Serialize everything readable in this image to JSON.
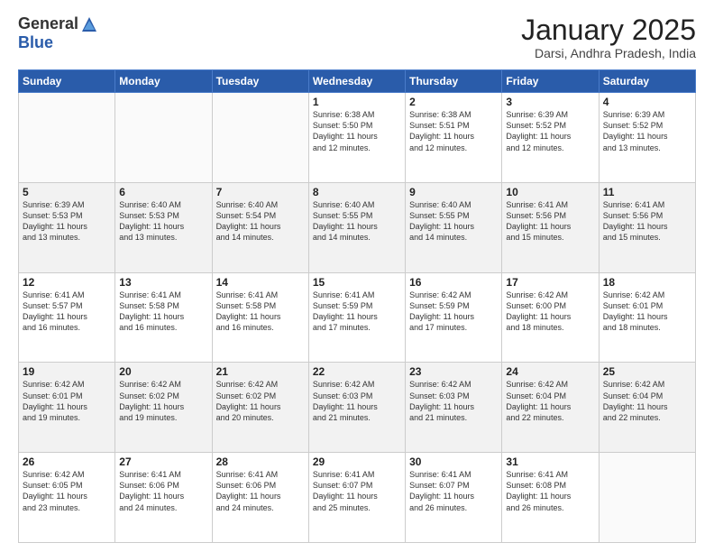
{
  "header": {
    "logo_general": "General",
    "logo_blue": "Blue",
    "month_title": "January 2025",
    "location": "Darsi, Andhra Pradesh, India"
  },
  "days_of_week": [
    "Sunday",
    "Monday",
    "Tuesday",
    "Wednesday",
    "Thursday",
    "Friday",
    "Saturday"
  ],
  "weeks": [
    [
      {
        "day": "",
        "info": ""
      },
      {
        "day": "",
        "info": ""
      },
      {
        "day": "",
        "info": ""
      },
      {
        "day": "1",
        "info": "Sunrise: 6:38 AM\nSunset: 5:50 PM\nDaylight: 11 hours\nand 12 minutes."
      },
      {
        "day": "2",
        "info": "Sunrise: 6:38 AM\nSunset: 5:51 PM\nDaylight: 11 hours\nand 12 minutes."
      },
      {
        "day": "3",
        "info": "Sunrise: 6:39 AM\nSunset: 5:52 PM\nDaylight: 11 hours\nand 12 minutes."
      },
      {
        "day": "4",
        "info": "Sunrise: 6:39 AM\nSunset: 5:52 PM\nDaylight: 11 hours\nand 13 minutes."
      }
    ],
    [
      {
        "day": "5",
        "info": "Sunrise: 6:39 AM\nSunset: 5:53 PM\nDaylight: 11 hours\nand 13 minutes."
      },
      {
        "day": "6",
        "info": "Sunrise: 6:40 AM\nSunset: 5:53 PM\nDaylight: 11 hours\nand 13 minutes."
      },
      {
        "day": "7",
        "info": "Sunrise: 6:40 AM\nSunset: 5:54 PM\nDaylight: 11 hours\nand 14 minutes."
      },
      {
        "day": "8",
        "info": "Sunrise: 6:40 AM\nSunset: 5:55 PM\nDaylight: 11 hours\nand 14 minutes."
      },
      {
        "day": "9",
        "info": "Sunrise: 6:40 AM\nSunset: 5:55 PM\nDaylight: 11 hours\nand 14 minutes."
      },
      {
        "day": "10",
        "info": "Sunrise: 6:41 AM\nSunset: 5:56 PM\nDaylight: 11 hours\nand 15 minutes."
      },
      {
        "day": "11",
        "info": "Sunrise: 6:41 AM\nSunset: 5:56 PM\nDaylight: 11 hours\nand 15 minutes."
      }
    ],
    [
      {
        "day": "12",
        "info": "Sunrise: 6:41 AM\nSunset: 5:57 PM\nDaylight: 11 hours\nand 16 minutes."
      },
      {
        "day": "13",
        "info": "Sunrise: 6:41 AM\nSunset: 5:58 PM\nDaylight: 11 hours\nand 16 minutes."
      },
      {
        "day": "14",
        "info": "Sunrise: 6:41 AM\nSunset: 5:58 PM\nDaylight: 11 hours\nand 16 minutes."
      },
      {
        "day": "15",
        "info": "Sunrise: 6:41 AM\nSunset: 5:59 PM\nDaylight: 11 hours\nand 17 minutes."
      },
      {
        "day": "16",
        "info": "Sunrise: 6:42 AM\nSunset: 5:59 PM\nDaylight: 11 hours\nand 17 minutes."
      },
      {
        "day": "17",
        "info": "Sunrise: 6:42 AM\nSunset: 6:00 PM\nDaylight: 11 hours\nand 18 minutes."
      },
      {
        "day": "18",
        "info": "Sunrise: 6:42 AM\nSunset: 6:01 PM\nDaylight: 11 hours\nand 18 minutes."
      }
    ],
    [
      {
        "day": "19",
        "info": "Sunrise: 6:42 AM\nSunset: 6:01 PM\nDaylight: 11 hours\nand 19 minutes."
      },
      {
        "day": "20",
        "info": "Sunrise: 6:42 AM\nSunset: 6:02 PM\nDaylight: 11 hours\nand 19 minutes."
      },
      {
        "day": "21",
        "info": "Sunrise: 6:42 AM\nSunset: 6:02 PM\nDaylight: 11 hours\nand 20 minutes."
      },
      {
        "day": "22",
        "info": "Sunrise: 6:42 AM\nSunset: 6:03 PM\nDaylight: 11 hours\nand 21 minutes."
      },
      {
        "day": "23",
        "info": "Sunrise: 6:42 AM\nSunset: 6:03 PM\nDaylight: 11 hours\nand 21 minutes."
      },
      {
        "day": "24",
        "info": "Sunrise: 6:42 AM\nSunset: 6:04 PM\nDaylight: 11 hours\nand 22 minutes."
      },
      {
        "day": "25",
        "info": "Sunrise: 6:42 AM\nSunset: 6:04 PM\nDaylight: 11 hours\nand 22 minutes."
      }
    ],
    [
      {
        "day": "26",
        "info": "Sunrise: 6:42 AM\nSunset: 6:05 PM\nDaylight: 11 hours\nand 23 minutes."
      },
      {
        "day": "27",
        "info": "Sunrise: 6:41 AM\nSunset: 6:06 PM\nDaylight: 11 hours\nand 24 minutes."
      },
      {
        "day": "28",
        "info": "Sunrise: 6:41 AM\nSunset: 6:06 PM\nDaylight: 11 hours\nand 24 minutes."
      },
      {
        "day": "29",
        "info": "Sunrise: 6:41 AM\nSunset: 6:07 PM\nDaylight: 11 hours\nand 25 minutes."
      },
      {
        "day": "30",
        "info": "Sunrise: 6:41 AM\nSunset: 6:07 PM\nDaylight: 11 hours\nand 26 minutes."
      },
      {
        "day": "31",
        "info": "Sunrise: 6:41 AM\nSunset: 6:08 PM\nDaylight: 11 hours\nand 26 minutes."
      },
      {
        "day": "",
        "info": ""
      }
    ]
  ]
}
